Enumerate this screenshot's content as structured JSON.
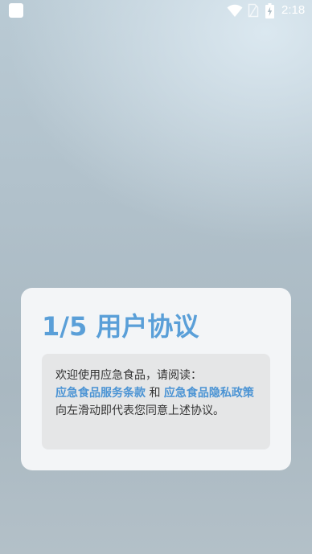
{
  "status_bar": {
    "time": "2:18",
    "icons": [
      "app-notification-icon",
      "wifi-icon",
      "sim-icon",
      "battery-charging-icon"
    ]
  },
  "dialog": {
    "title": "1/5 用户协议",
    "intro": "欢迎使用应急食品，请阅读：",
    "terms_link": "应急食品服务条款",
    "conjunction": "和",
    "privacy_link": "应急食品隐私政策",
    "footer": "向左滑动即代表您同意上述协议。"
  },
  "colors": {
    "accent": "#5a9fd8",
    "link": "#4a93d4",
    "card_bg": "#f3f5f7",
    "box_bg": "#e5e6e7",
    "text": "#333333"
  }
}
